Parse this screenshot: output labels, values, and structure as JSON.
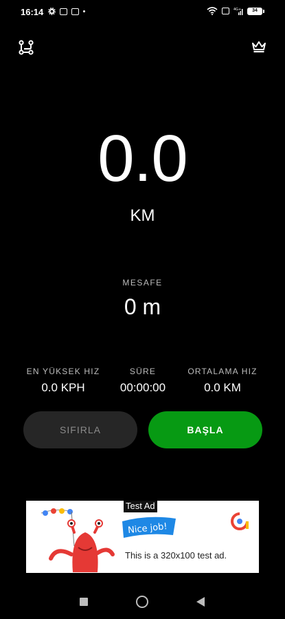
{
  "status_bar": {
    "time": "16:14",
    "battery": "34",
    "network": "4G+"
  },
  "icons": {
    "routes": "route-icon",
    "premium": "crown-icon"
  },
  "speed": {
    "value": "0.0",
    "unit": "KM"
  },
  "distance": {
    "label": "MESAFE",
    "value": "0 m"
  },
  "stats": {
    "max_speed_label": "EN YÜKSEK HIZ",
    "max_speed_value": "0.0 KPH",
    "duration_label": "SÜRE",
    "duration_value": "00:00:00",
    "avg_speed_label": "ORTALAMA HIZ",
    "avg_speed_value": "0.0 KM"
  },
  "buttons": {
    "reset": "SIFIRLA",
    "start": "BAŞLA"
  },
  "ad": {
    "tag": "Test Ad",
    "banner": "Nice job!",
    "text": "This is a 320x100 test ad."
  },
  "colors": {
    "background": "#000000",
    "start_button": "#079a13",
    "reset_button": "#262626"
  }
}
